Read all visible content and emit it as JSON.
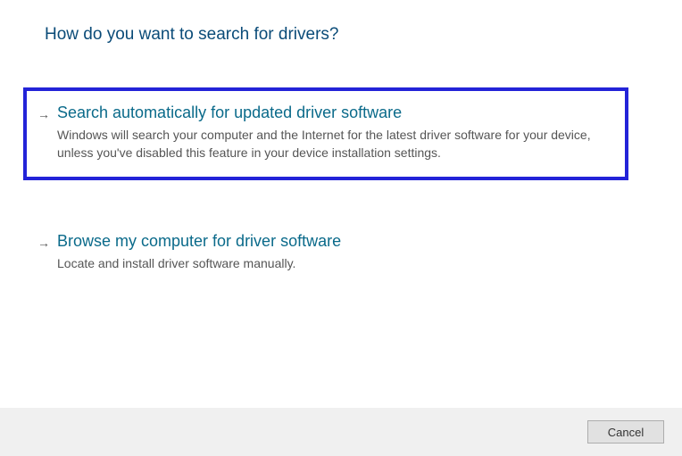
{
  "heading": "How do you want to search for drivers?",
  "options": [
    {
      "title": "Search automatically for updated driver software",
      "description": "Windows will search your computer and the Internet for the latest driver software for your device, unless you've disabled this feature in your device installation settings.",
      "highlighted": true
    },
    {
      "title": "Browse my computer for driver software",
      "description": "Locate and install driver software manually.",
      "highlighted": false
    }
  ],
  "footer": {
    "cancel_label": "Cancel"
  },
  "arrow_glyph": "→"
}
